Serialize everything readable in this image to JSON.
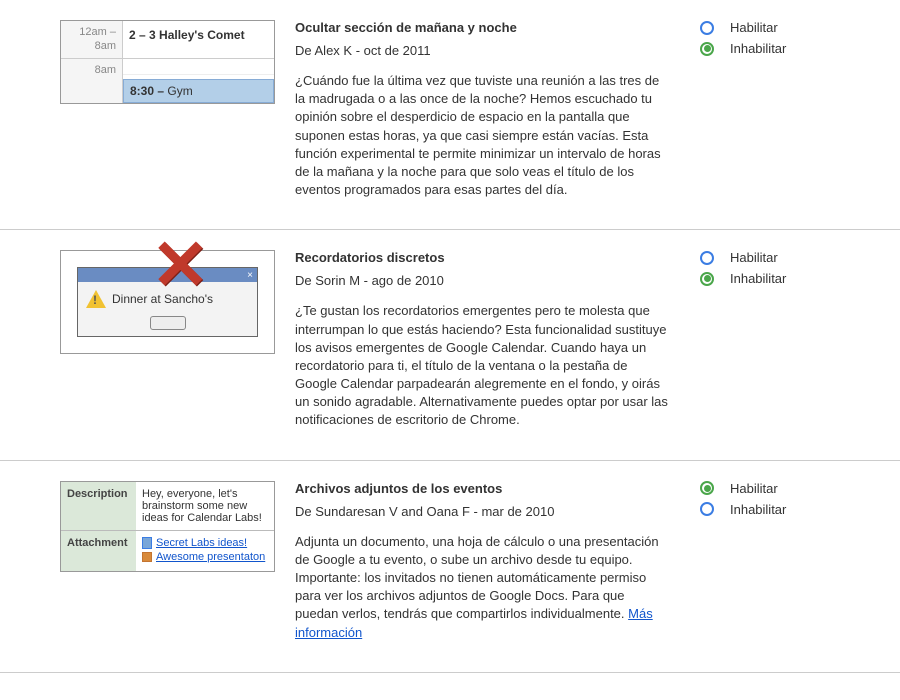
{
  "options": {
    "enable": "Habilitar",
    "disable": "Inhabilitar"
  },
  "features": [
    {
      "title": "Ocultar sección de mañana y noche",
      "author": "De Alex K - oct de 2011",
      "text": "¿Cuándo fue la última vez que tuviste una reunión a las tres de la madrugada o a las once de la noche? Hemos escuchado tu opinión sobre el desperdicio de espacio en la pantalla que suponen estas horas, ya que casi siempre están vacías. Esta función experimental te permite minimizar un intervalo de horas de la mañana y la noche para que solo veas el título de los eventos programados para esas partes del día.",
      "selected": "disable"
    },
    {
      "title": "Recordatorios discretos",
      "author": "De Sorin M - ago de 2010",
      "text": "¿Te gustan los recordatorios emergentes pero te molesta que interrumpan lo que estás haciendo? Esta funcionalidad sustituye los avisos emergentes de Google Calendar. Cuando haya un recordatorio para ti, el título de la ventana o la pestaña de Google Calendar parpadearán alegremente en el fondo, y oirás un sonido agradable. Alternativamente puedes optar por usar las notificaciones de escritorio de Chrome.",
      "selected": "disable"
    },
    {
      "title": "Archivos adjuntos de los eventos",
      "author": "De Sundaresan V and Oana F - mar de 2010",
      "text": "Adjunta un documento, una hoja de cálculo o una presentación de Google a tu evento, o sube un archivo desde tu equipo. Importante: los invitados no tienen automáticamente permiso para ver los archivos adjuntos de Google Docs. Para que puedan verlos, tendrás que compartirlos individualmente. ",
      "link": "Más información",
      "selected": "enable"
    }
  ],
  "thumb1": {
    "range": "12am –\n8am",
    "event1": "2 – 3  Halley's Comet",
    "time2": "8am",
    "event2time": "8:30 –",
    "event2": "Gym"
  },
  "thumb2": {
    "text": "Dinner at Sancho's",
    "close": "×"
  },
  "thumb3": {
    "desc_label": "Description",
    "desc_text": "Hey, everyone, let's brainstorm some new ideas for Calendar Labs!",
    "attach_label": "Attachment",
    "link1": "Secret Labs ideas!",
    "link2": "Awesome presentaton"
  }
}
